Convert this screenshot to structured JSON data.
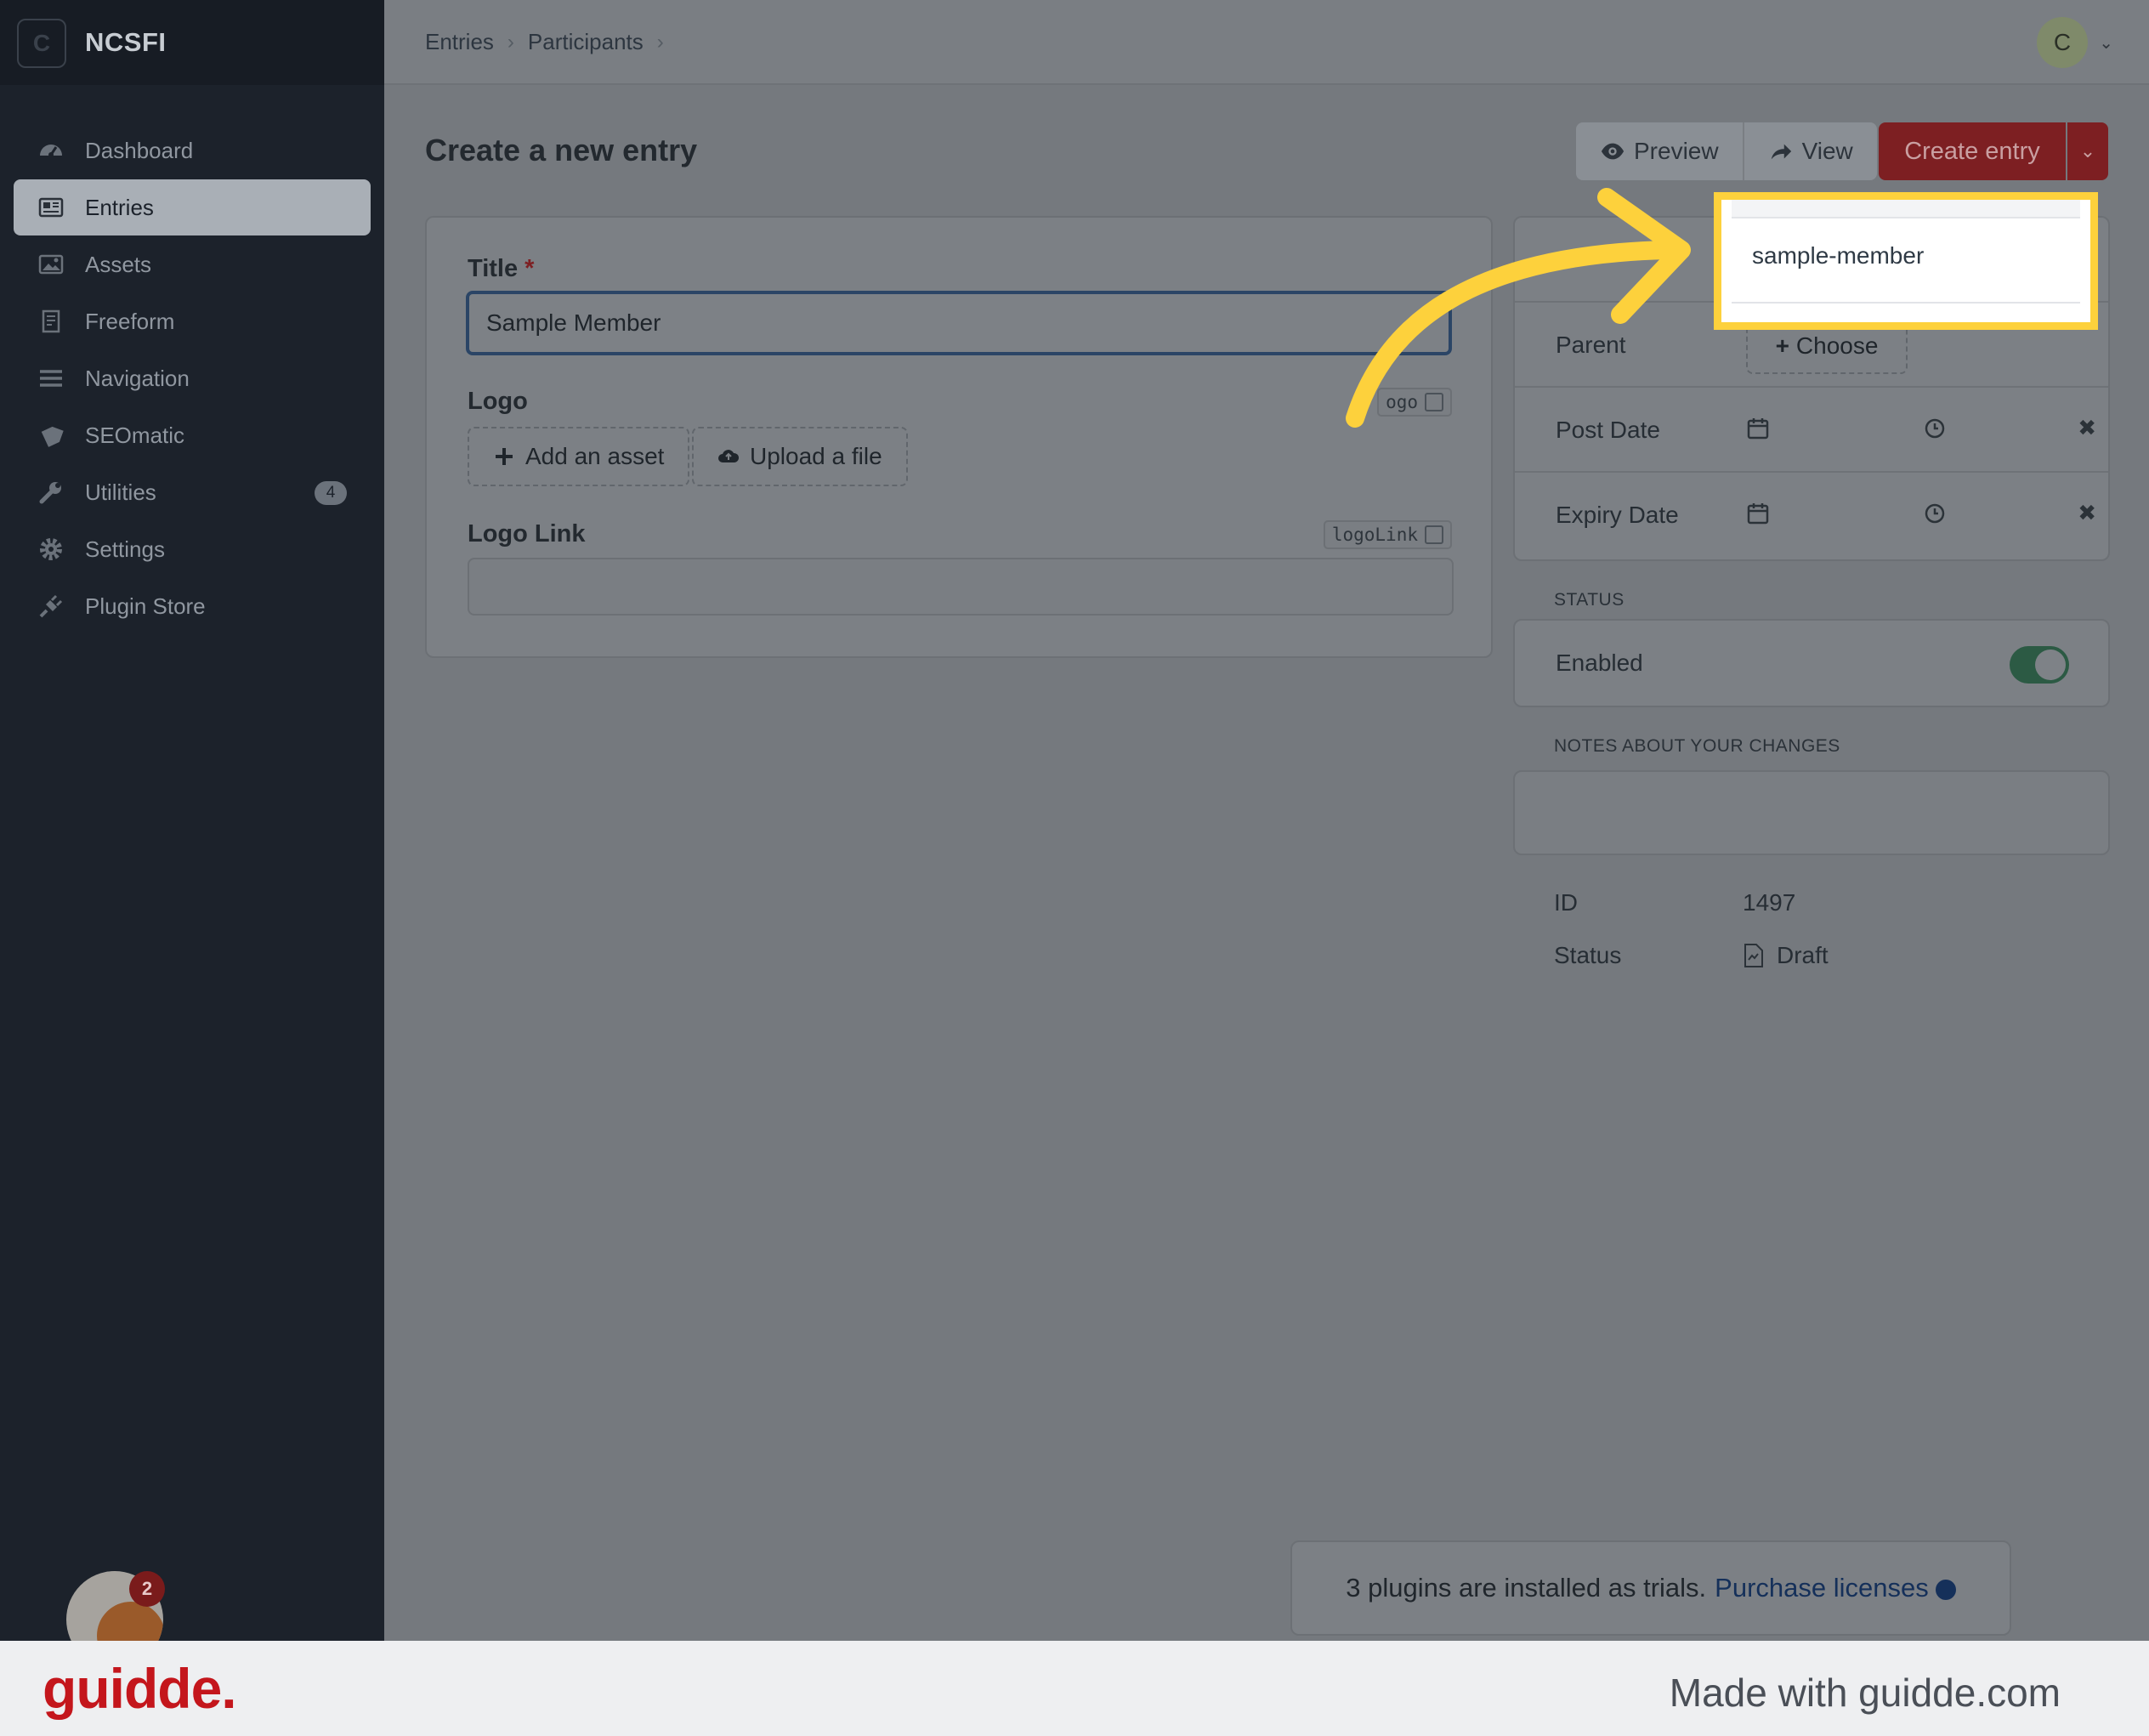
{
  "sidebar": {
    "logo_letter": "C",
    "site_name": "NCSFI",
    "items": [
      {
        "label": "Dashboard",
        "icon": "gauge-icon"
      },
      {
        "label": "Entries",
        "icon": "newspaper-icon",
        "active": true
      },
      {
        "label": "Assets",
        "icon": "image-icon"
      },
      {
        "label": "Freeform",
        "icon": "form-icon"
      },
      {
        "label": "Navigation",
        "icon": "menu-lines-icon"
      },
      {
        "label": "SEOmatic",
        "icon": "seo-tag-icon"
      },
      {
        "label": "Utilities",
        "icon": "wrench-icon",
        "badge": "4"
      },
      {
        "label": "Settings",
        "icon": "gear-icon"
      },
      {
        "label": "Plugin Store",
        "icon": "plug-icon"
      }
    ],
    "plugin_badge": "2"
  },
  "topbar": {
    "breadcrumb": [
      "Entries",
      "Participants"
    ],
    "user_initial": "C"
  },
  "header": {
    "title": "Create a new entry",
    "preview_label": "Preview",
    "view_label": "View",
    "create_label": "Create entry"
  },
  "fields": {
    "title_label": "Title",
    "title_required": "*",
    "title_value": "Sample Member",
    "logo_label": "Logo",
    "logo_handle": "ogo",
    "add_asset_label": "Add an asset",
    "upload_label": "Upload a file",
    "logo_link_label": "Logo Link",
    "logo_link_handle": "logoLink",
    "logo_link_value": ""
  },
  "meta": {
    "slug_value": "sample-member",
    "parent_label": "Parent",
    "choose_label": "Choose",
    "post_date_label": "Post Date",
    "expiry_date_label": "Expiry Date",
    "status_heading": "STATUS",
    "enabled_label": "Enabled",
    "enabled": true,
    "notes_heading": "NOTES ABOUT YOUR CHANGES",
    "id_label": "ID",
    "id_value": "1497",
    "status_label": "Status",
    "status_value": "Draft"
  },
  "notice": {
    "text": "3 plugins are installed as trials.",
    "link_label": "Purchase licenses"
  },
  "footer": {
    "brand": "guidde.",
    "made_with": "Made with guidde.com"
  },
  "colors": {
    "highlight": "#fdd13c",
    "brand_red": "#c4161c",
    "create_button": "#7d1f22"
  }
}
